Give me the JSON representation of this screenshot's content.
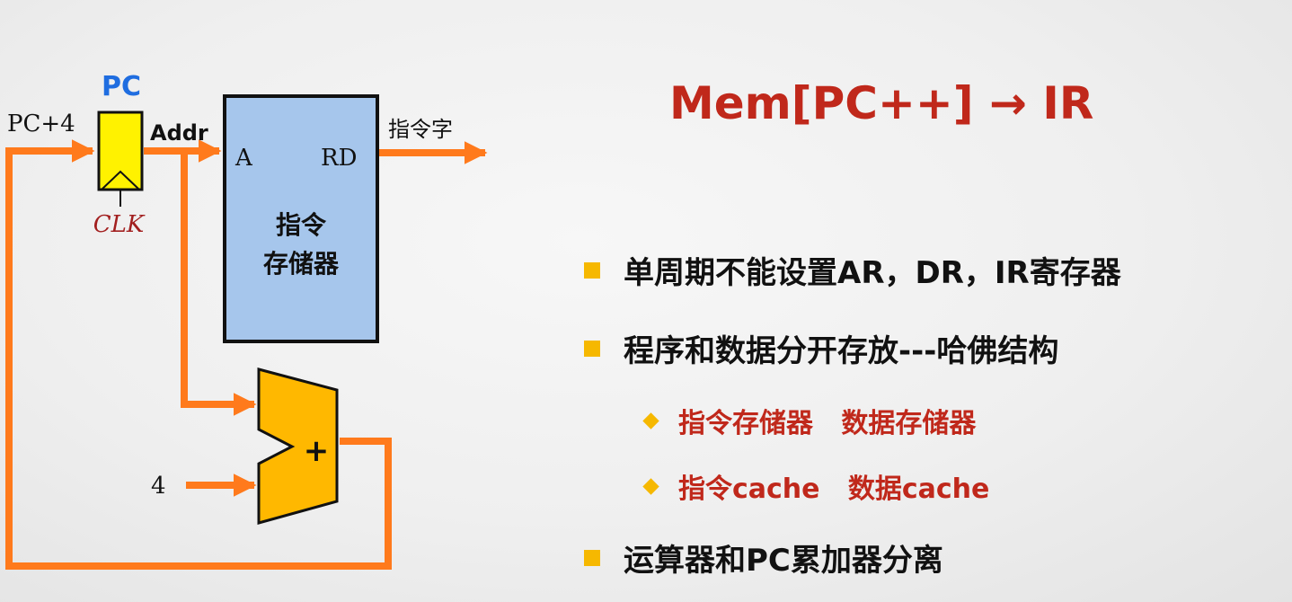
{
  "diagram": {
    "pc_label": "PC",
    "pc4_label": "PC+4",
    "addr_label": "Addr",
    "clk_label": "CLK",
    "mem_port_a": "A",
    "mem_port_rd": "RD",
    "mem_name_line1": "指令",
    "mem_name_line2": "存储器",
    "output_label": "指令字",
    "adder_symbol": "+",
    "const_four": "4"
  },
  "title": "Mem[PC++] → IR",
  "bullets": [
    {
      "text": "单周期不能设置AR，DR，IR寄存器"
    },
    {
      "text": "程序和数据分开存放---哈佛结构",
      "sub": [
        {
          "text": "指令存储器   数据存储器"
        },
        {
          "text": "指令cache   数据cache"
        }
      ]
    },
    {
      "text": "运算器和PC累加器分离"
    }
  ],
  "colors": {
    "wire": "#ff7a1c",
    "title": "#c0281b",
    "pc_label": "#1f6de0",
    "clk_label": "#a21f1f",
    "register_fill": "#fff200",
    "memory_fill": "#a6c6ec",
    "adder_fill": "#ffb800",
    "bullet_marker": "#f6b800"
  }
}
